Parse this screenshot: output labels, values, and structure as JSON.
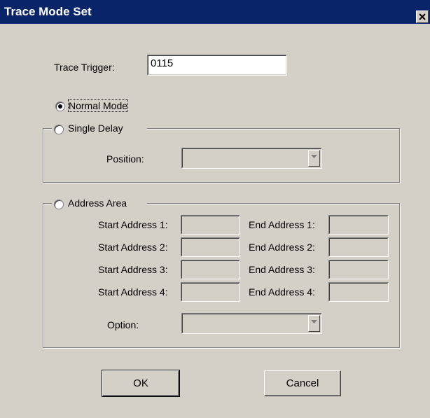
{
  "window": {
    "title": "Trace Mode Set",
    "close_label": "Close"
  },
  "trace_trigger": {
    "label": "Trace Trigger:",
    "value": "0115"
  },
  "modes": {
    "normal": {
      "label": "Normal Mode",
      "selected": true
    },
    "single_delay": {
      "label": "Single Delay",
      "selected": false
    },
    "address_area": {
      "label": "Address Area",
      "selected": false
    }
  },
  "single_delay": {
    "position_label": "Position:",
    "position_value": ""
  },
  "address_area": {
    "start_labels": [
      "Start Address 1:",
      "Start Address 2:",
      "Start Address 3:",
      "Start Address 4:"
    ],
    "end_labels": [
      "End Address 1:",
      "End Address 2:",
      "End Address 3:",
      "End Address 4:"
    ],
    "start_values": [
      "",
      "",
      "",
      ""
    ],
    "end_values": [
      "",
      "",
      "",
      ""
    ],
    "option_label": "Option:",
    "option_value": ""
  },
  "buttons": {
    "ok": "OK",
    "cancel": "Cancel"
  },
  "colors": {
    "titlebar": "#0a246a",
    "face": "#d4d0c8"
  }
}
